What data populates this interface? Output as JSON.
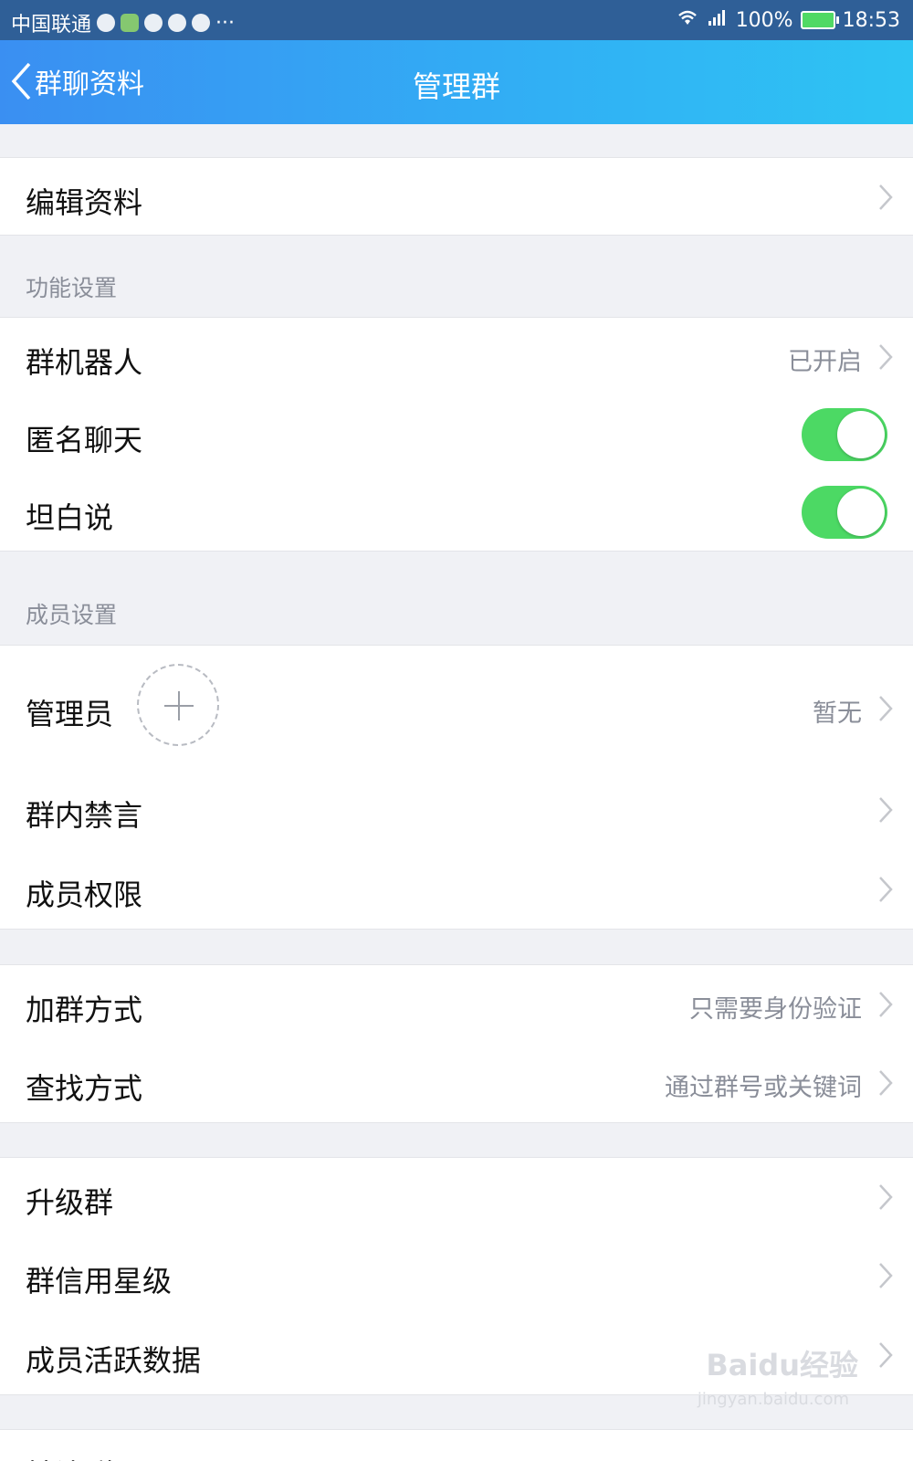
{
  "status_bar": {
    "carrier": "中国联通",
    "more": "···",
    "battery": "100%",
    "time": "18:53"
  },
  "nav": {
    "back_label": "群聊资料",
    "title": "管理群"
  },
  "rows": {
    "edit_profile": "编辑资料",
    "section_features": "功能设置",
    "group_robot": "群机器人",
    "group_robot_value": "已开启",
    "anonymous_chat": "匿名聊天",
    "anonymous_chat_on": true,
    "frank_talk": "坦白说",
    "frank_talk_on": true,
    "section_members": "成员设置",
    "admins": "管理员",
    "admins_value": "暂无",
    "group_mute": "群内禁言",
    "member_permissions": "成员权限",
    "join_method": "加群方式",
    "join_method_value": "只需要身份验证",
    "search_method": "查找方式",
    "search_method_value": "通过群号或关键词",
    "upgrade_group": "升级群",
    "group_credit": "群信用星级",
    "member_activity": "成员活跃数据",
    "partial_row": "转让群"
  },
  "watermark": {
    "brand": "Baidu经验",
    "url": "jingyan.baidu.com"
  },
  "colors": {
    "nav_gradient_start": "#3a8ff2",
    "nav_gradient_end": "#2ec4f3",
    "toggle_on": "#4cd964",
    "background": "#f0f1f5"
  }
}
